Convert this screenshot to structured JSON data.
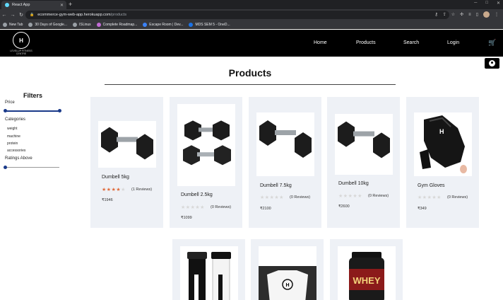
{
  "browser": {
    "tab_title": "React App",
    "url_host": "ecommerce-gym-web-app.herokuapp.com",
    "url_path": "/products",
    "bookmarks": [
      "New Tab",
      "30 Days of Google...",
      "ISLinux",
      "Complete Roadmap...",
      "Escape Room | Dev...",
      "MDS SEM 5 - OneD..."
    ]
  },
  "nav": {
    "logo_text": "LEVELUP FITNESS CENTRE",
    "links": [
      "Home",
      "Products",
      "Search",
      "Login"
    ]
  },
  "page": {
    "title": "Products"
  },
  "filters": {
    "title": "Filters",
    "price_label": "Price",
    "categories_label": "Categories",
    "categories": [
      "weight",
      "machine",
      "protein",
      "accessories"
    ],
    "ratings_label": "Ratings Above"
  },
  "products": [
    {
      "name": "Dumbell 5kg",
      "rating": 4,
      "reviews": "(1 Reviews)",
      "price": "₹1946"
    },
    {
      "name": "Dumbell 2.5kg",
      "rating": 0,
      "reviews": "(0 Reviews)",
      "price": "₹1099"
    },
    {
      "name": "Dumbell 7.5kg",
      "rating": 0,
      "reviews": "(0 Reviews)",
      "price": "₹2100"
    },
    {
      "name": "Dumbell 10kg",
      "rating": 0,
      "reviews": "(0 Reviews)",
      "price": "₹2600"
    },
    {
      "name": "Gym Gloves",
      "rating": 0,
      "reviews": "(0 Reviews)",
      "price": "₹349"
    }
  ],
  "colors": {
    "accent": "#1a3a8a",
    "star": "#e06b3c",
    "card_bg": "#eef1f6"
  }
}
